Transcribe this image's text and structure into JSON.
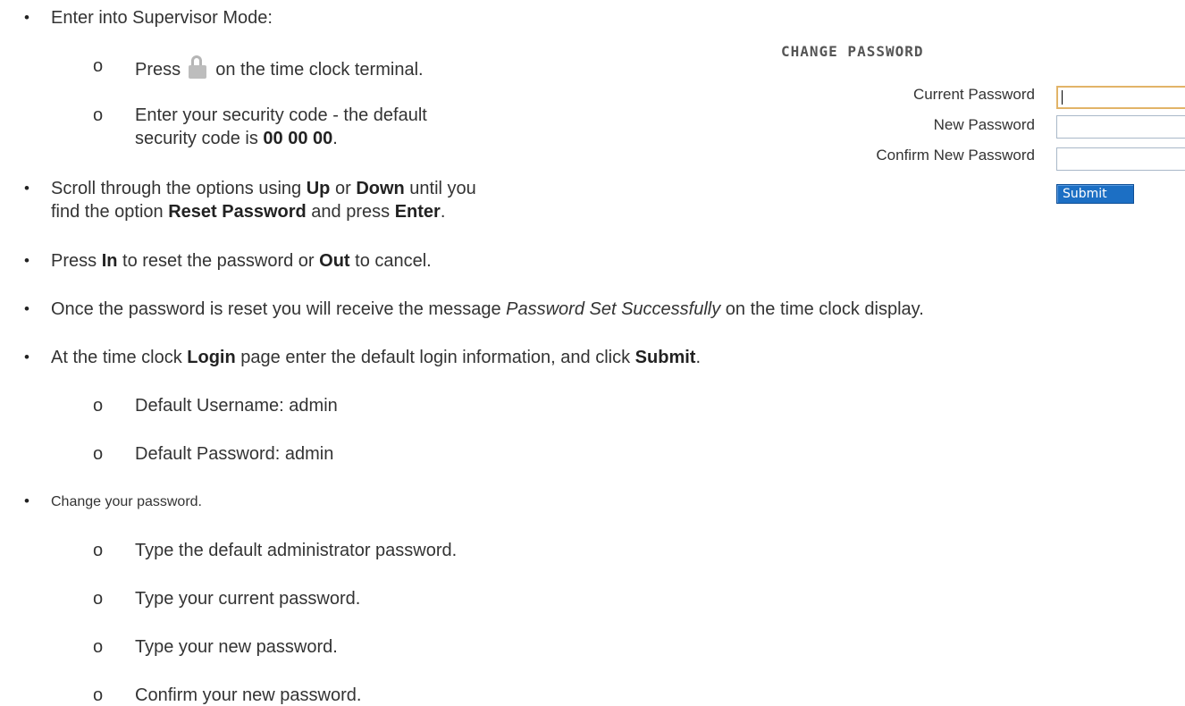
{
  "steps": [
    {
      "text": "Enter into Supervisor Mode:"
    },
    {
      "sub": [
        {
          "prefix": "Press",
          "icon": "lock-icon",
          "suffix": "on the time clock terminal."
        },
        {
          "line1": "Enter your security code - the default",
          "line2_pre": "security code is ",
          "line2_bold": "00 00 00",
          "line2_post": "."
        }
      ]
    },
    {
      "line1_pre": "Scroll through the options using ",
      "b1": "Up",
      "mid1": " or ",
      "b2": "Down",
      "line1_post": " until you",
      "line2_pre": "find the option ",
      "b3": "Reset Password",
      "mid2": " and press ",
      "b4": "Enter",
      "line2_post": "."
    },
    {
      "pre": "Press ",
      "b1": "In",
      "mid": " to reset the password or ",
      "b2": "Out",
      "post": " to cancel."
    },
    {
      "pre": "Once the password is reset you will receive the message ",
      "em": "Password Set Successfully",
      "post": " on the time clock display."
    },
    {
      "pre": "At the time clock ",
      "b1": "Login",
      "mid": " page enter the default login information, and click ",
      "b2": "Submit",
      "post": "."
    },
    {
      "sub": [
        "Default Username: admin",
        "Default Password: admin"
      ]
    },
    {
      "text": "Change your password."
    },
    {
      "sub": [
        "Type the default administrator password.",
        "Type your current password.",
        "Type your new password.",
        "Confirm your new password."
      ]
    }
  ],
  "sub_marker": "o",
  "bullet_marker": "•",
  "change_password": {
    "title": "CHANGE PASSWORD",
    "current_label": "Current Password",
    "new_label": "New Password",
    "confirm_label": "Confirm New Password",
    "submit_label": "Submit"
  }
}
